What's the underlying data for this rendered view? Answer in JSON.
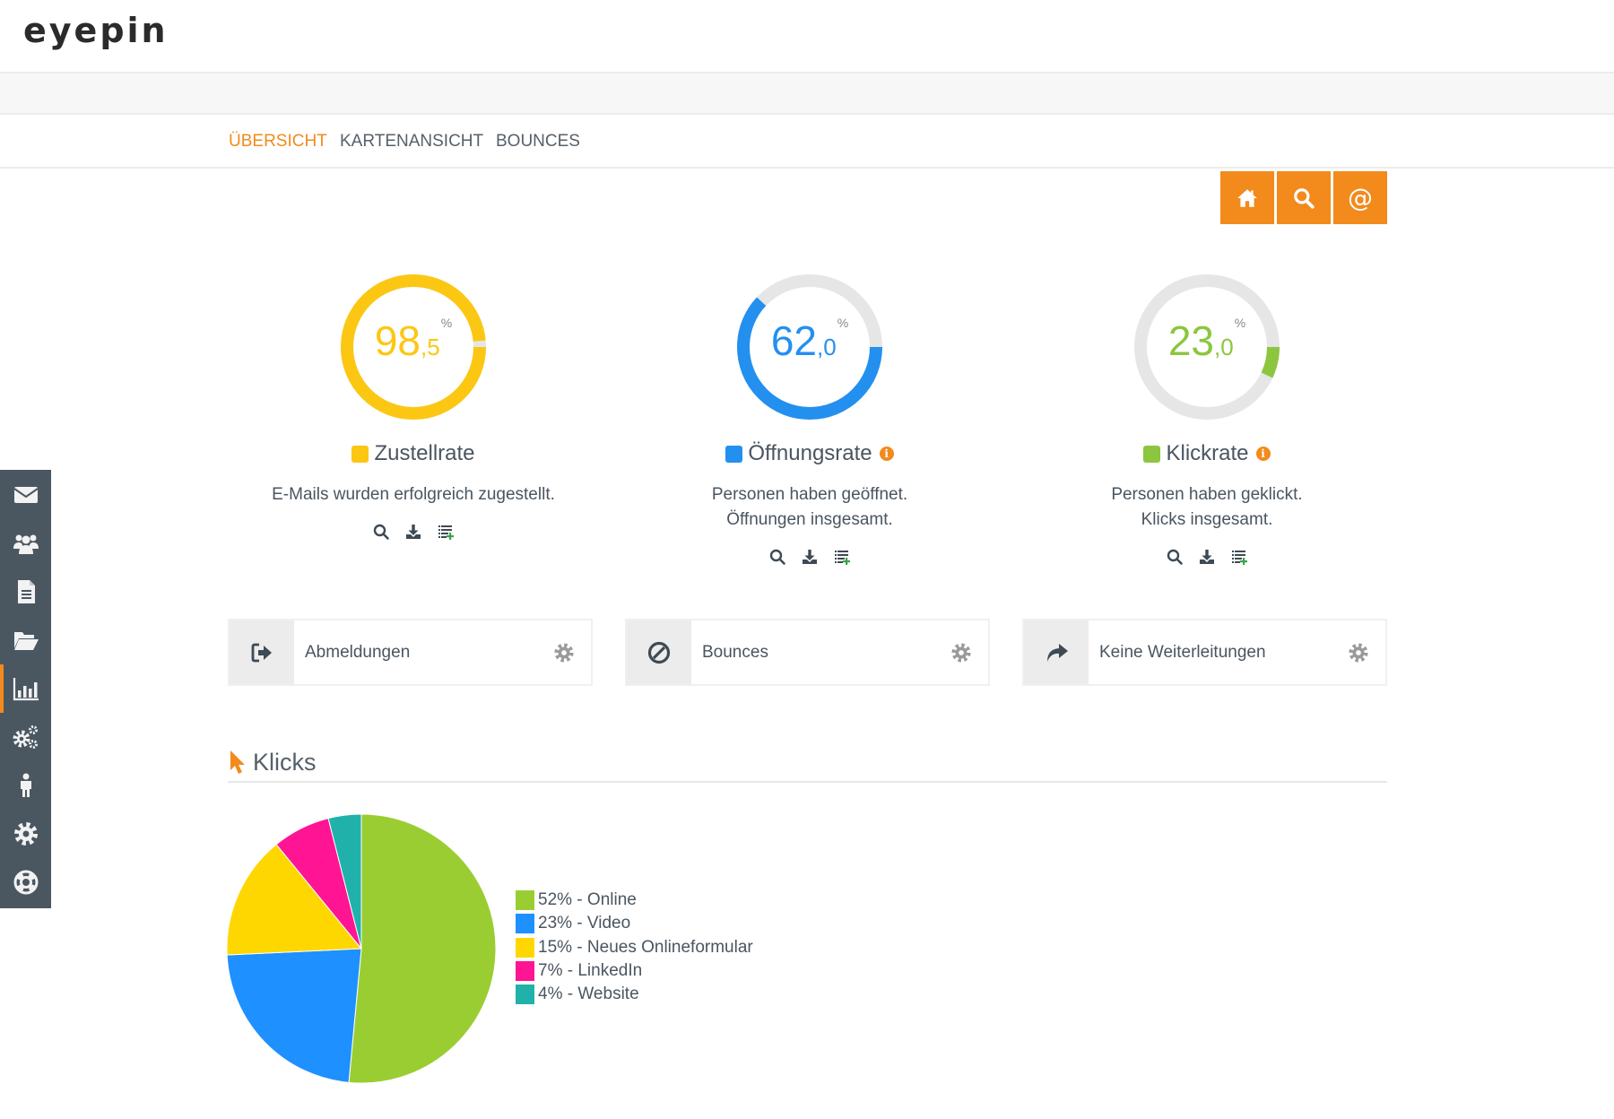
{
  "app": {
    "logo": "eyepin"
  },
  "subnav": {
    "tabs": [
      {
        "label": "ÜBERSICHT",
        "active": true
      },
      {
        "label": "KARTENANSICHT",
        "active": false
      },
      {
        "label": "BOUNCES",
        "active": false
      }
    ]
  },
  "toolbar": {
    "buttons": [
      {
        "icon": "home-icon"
      },
      {
        "icon": "search-icon"
      },
      {
        "icon": "at-icon",
        "glyph": "@"
      }
    ]
  },
  "sidebar": {
    "items": [
      {
        "icon": "envelope-icon",
        "active": false
      },
      {
        "icon": "users-icon",
        "active": false
      },
      {
        "icon": "document-icon",
        "active": false
      },
      {
        "icon": "folder-open-icon",
        "active": false
      },
      {
        "icon": "bar-chart-icon",
        "active": true
      },
      {
        "icon": "cogs-icon",
        "active": false
      },
      {
        "icon": "person-icon",
        "active": false
      },
      {
        "icon": "gear-icon",
        "active": false
      },
      {
        "icon": "life-ring-icon",
        "active": false
      }
    ]
  },
  "colors": {
    "accent": "#f28a1c",
    "sidebar_bg": "#4a5761",
    "zustellrate": "#fcc713",
    "oeffnungsrate": "#2390f0",
    "klickrate": "#8cc63f",
    "track": "#e6e6e6"
  },
  "kpis": [
    {
      "id": "zustellrate",
      "int": "98",
      "dec": ",5",
      "pct": "%",
      "value_percent": 98.5,
      "title": "Zustellrate",
      "has_info": false,
      "desc_lines": [
        "E-Mails wurden erfolgreich zugestellt."
      ],
      "color": "#fcc713"
    },
    {
      "id": "oeffnungsrate",
      "int": "62",
      "dec": ",0",
      "pct": "%",
      "value_percent": 62.0,
      "title": "Öffnungsrate",
      "has_info": true,
      "desc_lines": [
        "Personen haben geöffnet.",
        "Öffnungen insgesamt."
      ],
      "color": "#2390f0"
    },
    {
      "id": "klickrate",
      "int": "23",
      "dec": ",0",
      "pct": "%",
      "value_percent": 23.0,
      "arc_shown_percent": 7,
      "title": "Klickrate",
      "has_info": true,
      "desc_lines": [
        "Personen haben geklickt.",
        "Klicks insgesamt."
      ],
      "color": "#8cc63f"
    }
  ],
  "kpi_actions": [
    {
      "icon": "search-icon"
    },
    {
      "icon": "download-icon"
    },
    {
      "icon": "list-add-icon"
    }
  ],
  "cards": [
    {
      "icon": "sign-out-icon",
      "label": "Abmeldungen"
    },
    {
      "icon": "ban-icon",
      "label": "Bounces"
    },
    {
      "icon": "share-icon",
      "label": "Keine Weiterleitungen"
    }
  ],
  "clicks_section": {
    "title": "Klicks"
  },
  "chart_data": {
    "type": "pie",
    "title": "Klicks",
    "categories": [
      "Online",
      "Video",
      "Neues Onlineformular",
      "LinkedIn",
      "Website"
    ],
    "values": [
      52,
      23,
      15,
      7,
      4
    ],
    "unit": "%",
    "colors": [
      "#9acd32",
      "#1e90ff",
      "#ffd700",
      "#ff1493",
      "#20b2aa"
    ],
    "legend_labels": [
      "52% - Online",
      "23% - Video",
      "15% - Neues Onlineformular",
      "7% - LinkedIn",
      "4% - Website"
    ],
    "legend_position": "right",
    "start_angle": "top",
    "direction": "clockwise"
  }
}
